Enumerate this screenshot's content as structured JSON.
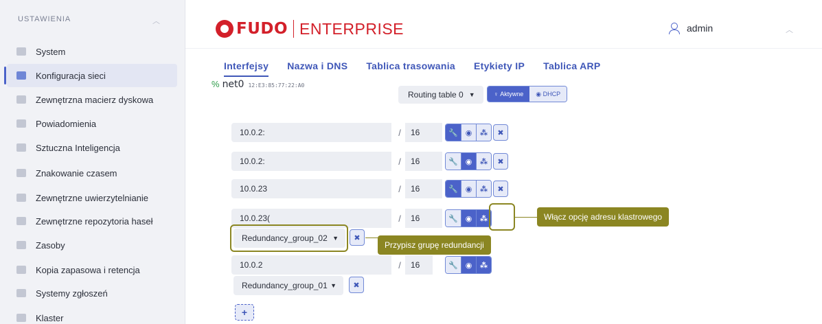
{
  "sidebar": {
    "header": "USTAWIENIA",
    "collapse_icon": "chevron-up-icon",
    "items": [
      {
        "label": "System",
        "icon": "folder-icon"
      },
      {
        "label": "Konfiguracja sieci",
        "icon": "network-icon",
        "active": true
      },
      {
        "label": "Zewnętrzna macierz dyskowa",
        "icon": "storage-icon"
      },
      {
        "label": "Powiadomienia",
        "icon": "megaphone-icon"
      },
      {
        "label": "Sztuczna Inteligencja",
        "icon": "brain-icon"
      },
      {
        "label": "Znakowanie czasem",
        "icon": "stamp-icon"
      },
      {
        "label": "Zewnętrzne uwierzytelnianie",
        "icon": "key-icon"
      },
      {
        "label": "Zewnętrzne repozytoria haseł",
        "icon": "vault-icon"
      },
      {
        "label": "Zasoby",
        "icon": "resources-icon"
      },
      {
        "label": "Kopia zapasowa i retencja",
        "icon": "archive-icon"
      },
      {
        "label": "Systemy zgłoszeń",
        "icon": "ticket-icon"
      },
      {
        "label": "Klaster",
        "icon": "cluster-icon"
      }
    ]
  },
  "header": {
    "logo_primary": "FUDO",
    "logo_secondary": "ENTERPRISE",
    "user_name": "admin",
    "brand_color": "#d3202a"
  },
  "tabs": [
    {
      "label": "Interfejsy",
      "active": true
    },
    {
      "label": "Nazwa i DNS"
    },
    {
      "label": "Tablica trasowania"
    },
    {
      "label": "Etykiety IP"
    },
    {
      "label": "Tablica ARP"
    }
  ],
  "interface": {
    "name": "net0",
    "mac": "12:E3:85:77:22:A0",
    "routing_table": "Routing table 0",
    "status_active": "Aktywne",
    "status_dhcp": "DHCP"
  },
  "addresses": [
    {
      "ip": "10.0.2:",
      "mask": "16"
    },
    {
      "ip": "10.0.2:",
      "mask": "16"
    },
    {
      "ip": "10.0.23",
      "mask": "16"
    },
    {
      "ip": "10.0.23(",
      "mask": "16",
      "group": "Redundancy_group_02"
    },
    {
      "ip": "10.0.2",
      "mask": "16",
      "group": "Redundancy_group_01"
    }
  ],
  "annotations": {
    "cluster_tooltip": "Włącz opcję adresu klastrowego",
    "redundancy_tooltip": "Przypisz grupę redundancji",
    "accent_color": "#8b8622"
  },
  "add_label": "+"
}
